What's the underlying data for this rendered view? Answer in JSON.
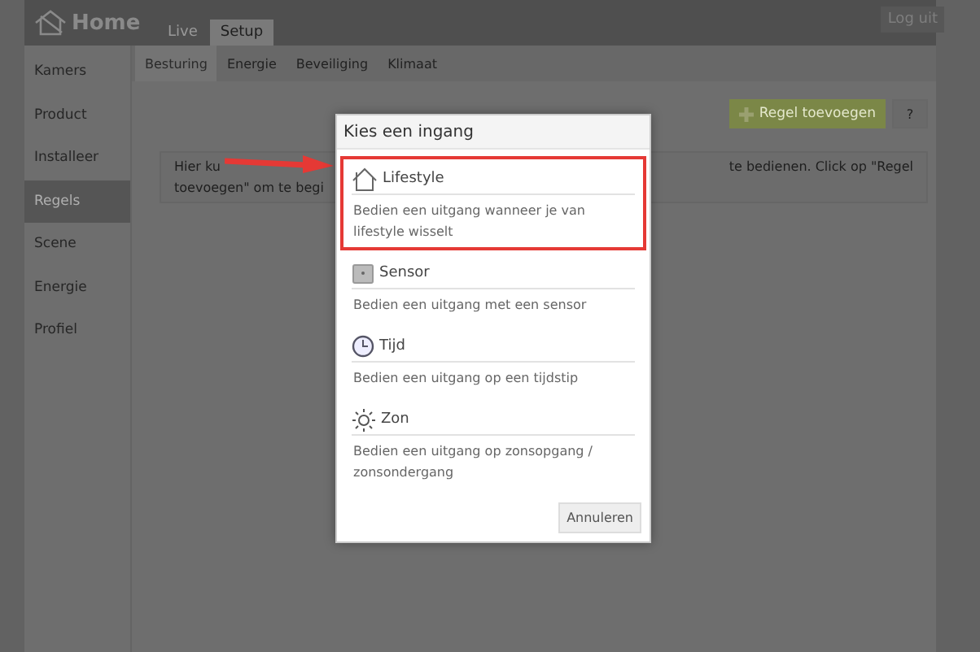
{
  "header": {
    "title": "Home",
    "logout": "Log uit"
  },
  "top_tabs": [
    {
      "label": "Live",
      "selected": false
    },
    {
      "label": "Setup",
      "selected": true
    }
  ],
  "sub_tabs": [
    {
      "label": "Besturing",
      "selected": true
    },
    {
      "label": "Energie",
      "selected": false
    },
    {
      "label": "Beveiliging",
      "selected": false
    },
    {
      "label": "Klimaat",
      "selected": false
    }
  ],
  "sidebar": {
    "items": [
      {
        "label": "Kamers",
        "selected": false
      },
      {
        "label": "Product",
        "selected": false
      },
      {
        "label": "Installeer",
        "selected": false
      },
      {
        "label": "Regels",
        "selected": true
      },
      {
        "label": "Scene",
        "selected": false
      },
      {
        "label": "Energie",
        "selected": false
      },
      {
        "label": "Profiel",
        "selected": false
      }
    ]
  },
  "toolbar": {
    "add_button": "Regel toevoegen",
    "help_button": "?"
  },
  "info_box": {
    "left_lines": [
      "Hier ku",
      "toevoegen\" om te begi"
    ],
    "right_lines": [
      "te bedienen. Click op \"Regel"
    ]
  },
  "dialog": {
    "title": "Kies een ingang",
    "options": [
      {
        "kind": "lifestyle",
        "label": "Lifestyle",
        "description": "Bedien een uitgang wanneer je van lifestyle wisselt",
        "selected": true
      },
      {
        "kind": "sensor",
        "label": "Sensor",
        "description": "Bedien een uitgang met een sensor",
        "selected": false
      },
      {
        "kind": "time",
        "label": "Tijd",
        "description": "Bedien een uitgang op een tijdstip",
        "selected": false
      },
      {
        "kind": "sun",
        "label": "Zon",
        "description": "Bedien een uitgang op zonsopgang / zonsondergang",
        "selected": false
      }
    ],
    "cancel_button": "Annuleren"
  }
}
